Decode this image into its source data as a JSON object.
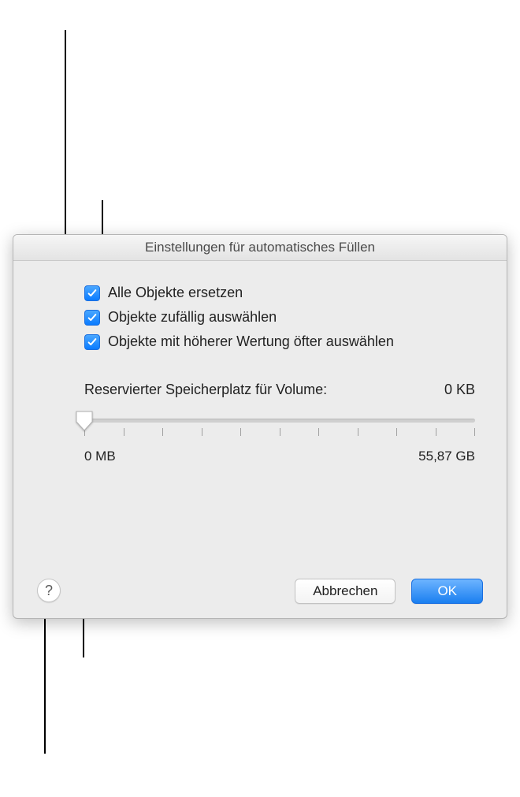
{
  "dialog": {
    "title": "Einstellungen für automatisches Füllen",
    "checkboxes": [
      {
        "label": "Alle Objekte ersetzen",
        "checked": true
      },
      {
        "label": "Objekte zufällig auswählen",
        "checked": true
      },
      {
        "label": "Objekte mit höherer Wertung öfter auswählen",
        "checked": true
      }
    ],
    "reserved": {
      "label": "Reservierter Speicherplatz für Volume:",
      "value": "0 KB",
      "min_label": "0 MB",
      "max_label": "55,87 GB",
      "slider_position": 0
    },
    "buttons": {
      "cancel": "Abbrechen",
      "ok": "OK"
    },
    "help": "?"
  }
}
